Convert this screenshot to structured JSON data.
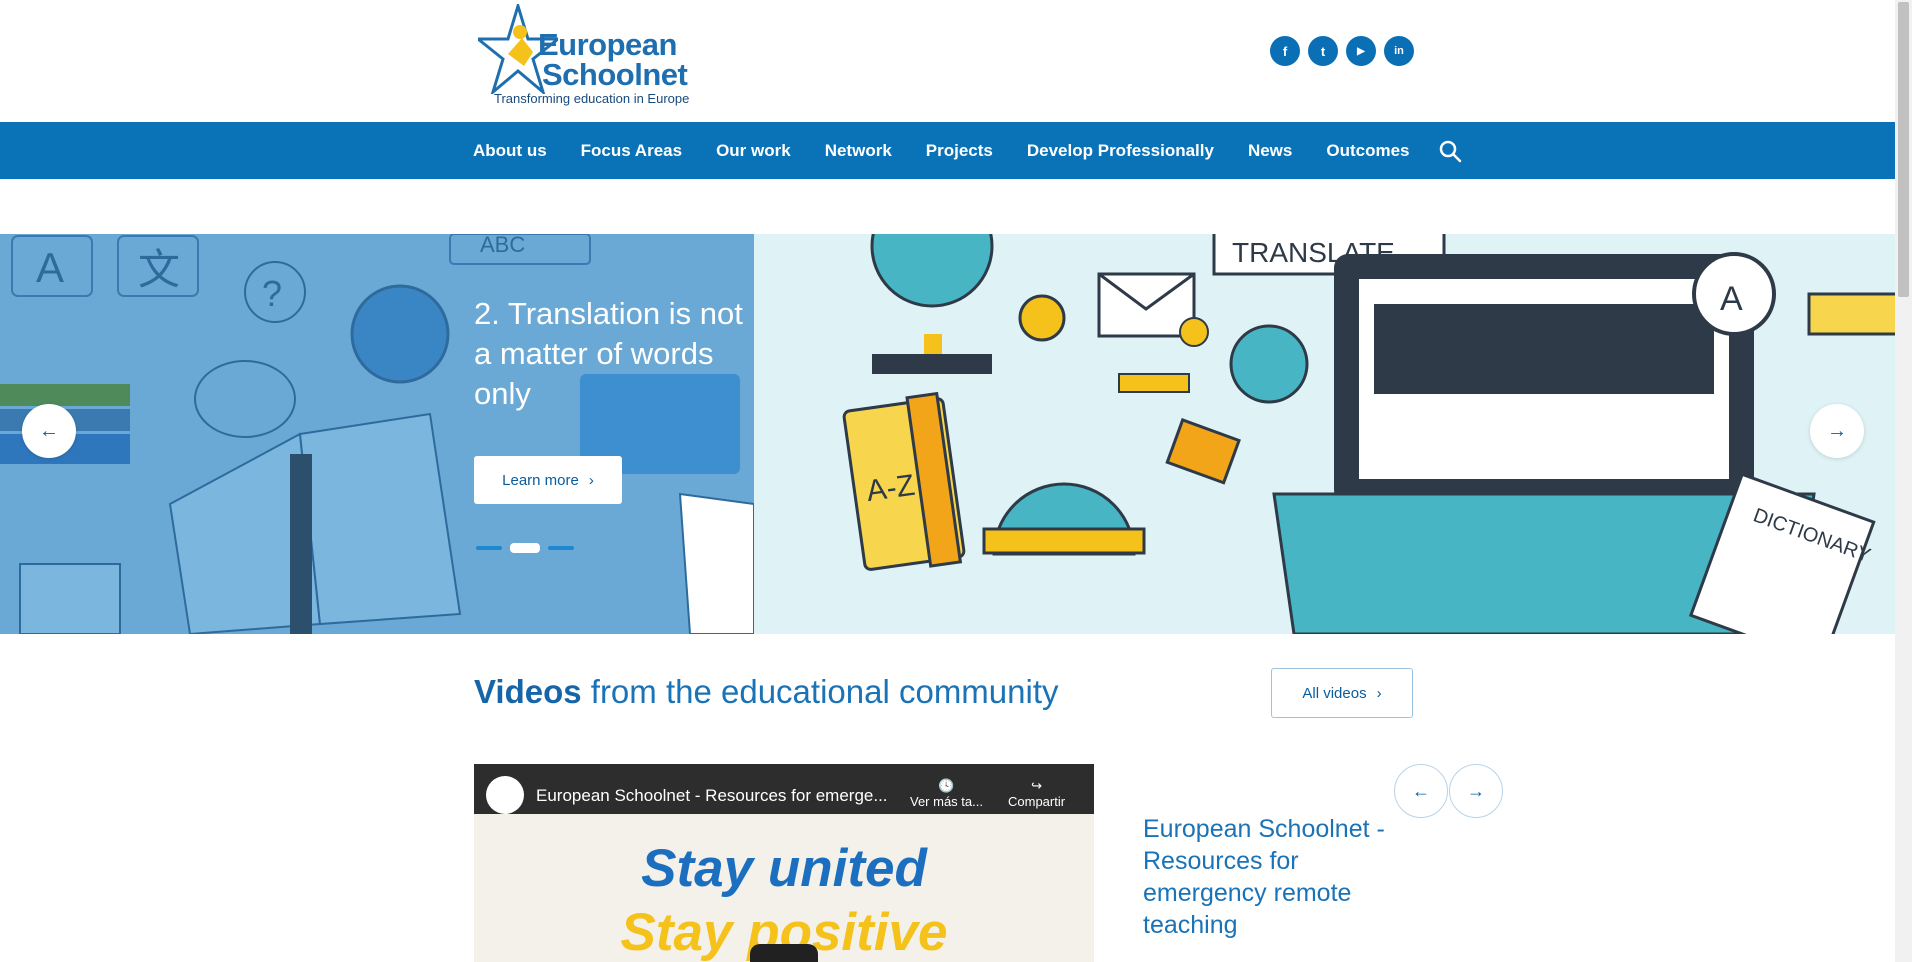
{
  "header": {
    "logo_line1": "European",
    "logo_line2": "Schoolnet",
    "logo_tagline": "Transforming education in Europe",
    "social": [
      {
        "icon": "facebook-icon",
        "glyph": "f"
      },
      {
        "icon": "twitter-icon",
        "glyph": "t"
      },
      {
        "icon": "youtube-icon",
        "glyph": "▶"
      },
      {
        "icon": "linkedin-icon",
        "glyph": "in"
      }
    ]
  },
  "nav": {
    "items": [
      "About us",
      "Focus Areas",
      "Our work",
      "Network",
      "Projects",
      "Develop Professionally",
      "News",
      "Outcomes"
    ],
    "search_icon": "search-icon"
  },
  "hero": {
    "title": "2. Translation is not a matter of words only",
    "button_label": "Learn more",
    "slides_total": 3,
    "active_slide": 2,
    "illustration_text": {
      "translate": "TRANSLATE...",
      "az": "A-Z",
      "dictionary": "DICTIONARY",
      "letter_a": "A",
      "letter_x": "文",
      "abc": "ABC"
    }
  },
  "videos": {
    "title_bold": "Videos",
    "title_rest": " from the educational community",
    "all_videos_label": "All videos",
    "video": {
      "title": "European Schoolnet - Resources for emerge...",
      "watch_later": "Ver más ta...",
      "share": "Compartir",
      "line1": "Stay united",
      "line2": "Stay positive"
    },
    "caption": "European Schoolnet - Resources for emergency remote teaching"
  },
  "colors": {
    "brand_blue": "#0a73b8",
    "hero_left": "#6aa9d6",
    "hero_right": "#dff3f6",
    "accent_yellow": "#f4c21a"
  }
}
